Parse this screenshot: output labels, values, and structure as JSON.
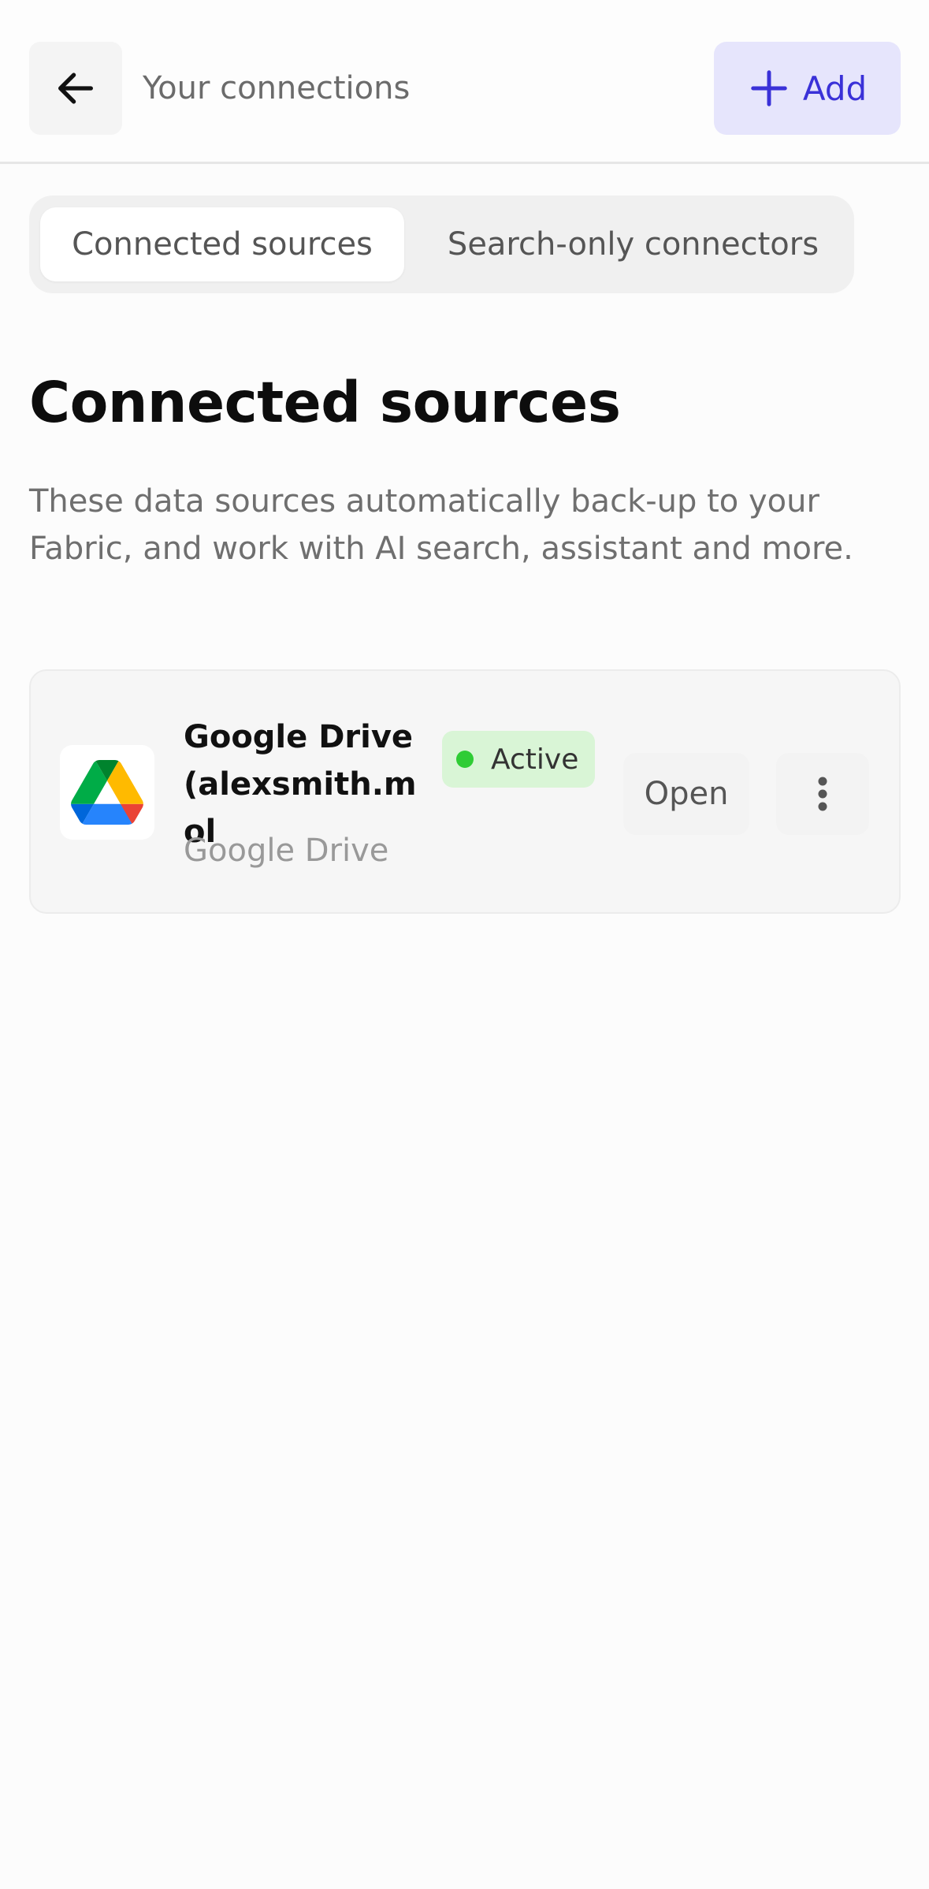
{
  "header": {
    "title": "Your connections",
    "add_label": "Add",
    "back_icon": "arrow-left-icon",
    "add_icon": "plus-icon",
    "accent_color": "#3a31d8",
    "add_bg": "#e6e5fc"
  },
  "tabs": [
    {
      "label": "Connected sources",
      "active": true
    },
    {
      "label": "Search-only connectors",
      "active": false
    }
  ],
  "main": {
    "title": "Connected sources",
    "description": "These data sources automatically back-up to your Fabric, and work with AI search, assistant and more."
  },
  "sources": [
    {
      "name": "Google Drive (alexsmith.mol",
      "type": "Google Drive",
      "status": "Active",
      "status_color": "#2fcc35",
      "open_label": "Open",
      "icon": "google-drive-icon",
      "more_icon": "more-vertical-icon"
    }
  ]
}
